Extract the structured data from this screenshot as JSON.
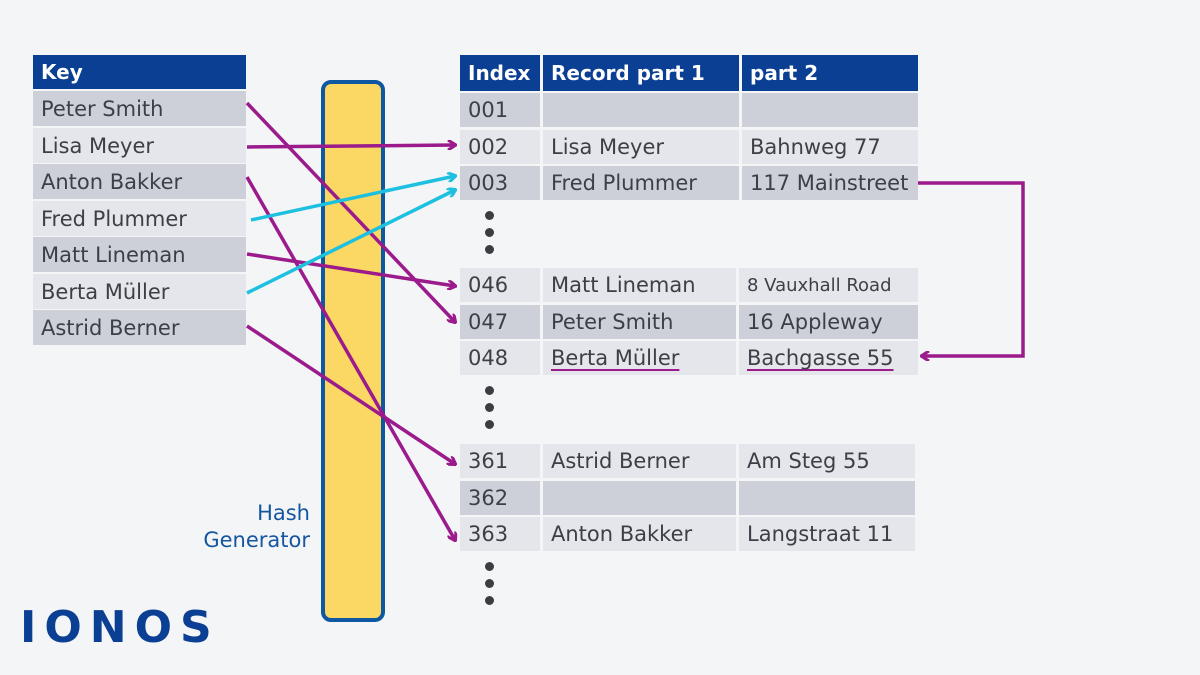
{
  "keys_table": {
    "header": "Key",
    "rows": [
      "Peter Smith",
      "Lisa Meyer",
      "Anton Bakker",
      "Fred Plummer",
      "Matt Lineman",
      "Berta Müller",
      "Astrid Berner"
    ]
  },
  "hash": {
    "label_line1": "Hash",
    "label_line2": "Generator"
  },
  "records_table": {
    "headers": [
      "Index",
      "Record part 1",
      "part 2"
    ],
    "groups": [
      [
        {
          "index": "001",
          "part1": "",
          "part2": ""
        },
        {
          "index": "002",
          "part1": "Lisa Meyer",
          "part2": "Bahnweg 77"
        },
        {
          "index": "003",
          "part1": "Fred Plummer",
          "part2": "117 Mainstreet"
        }
      ],
      [
        {
          "index": "046",
          "part1": "Matt Lineman",
          "part2": "8 Vauxhall Road"
        },
        {
          "index": "047",
          "part1": "Peter Smith",
          "part2": "16 Appleway"
        },
        {
          "index": "048",
          "part1": "Berta Müller",
          "part2": "Bachgasse 55"
        }
      ],
      [
        {
          "index": "361",
          "part1": "Astrid Berner",
          "part2": "Am Steg 55"
        },
        {
          "index": "362",
          "part1": "",
          "part2": ""
        },
        {
          "index": "363",
          "part1": "Anton Bakker",
          "part2": "Langstraat 11"
        }
      ]
    ]
  },
  "mappings": [
    {
      "key": "Peter Smith",
      "index": "047",
      "type": "direct"
    },
    {
      "key": "Lisa Meyer",
      "index": "002",
      "type": "direct"
    },
    {
      "key": "Anton Bakker",
      "index": "363",
      "type": "direct"
    },
    {
      "key": "Fred Plummer",
      "index": "003",
      "type": "collision"
    },
    {
      "key": "Matt Lineman",
      "index": "046",
      "type": "direct"
    },
    {
      "key": "Berta Müller",
      "index": "003",
      "type": "collision"
    },
    {
      "key": "Astrid Berner",
      "index": "361",
      "type": "direct"
    }
  ],
  "overflow_link": {
    "from": "003",
    "to": "048"
  },
  "colors": {
    "header": "#0b3f93",
    "arrow": "#9b1a8c",
    "collision_arrow": "#1ec0e0",
    "hash_fill": "#fbd764",
    "hash_border": "#0d58a0"
  },
  "logo": "IONOS"
}
